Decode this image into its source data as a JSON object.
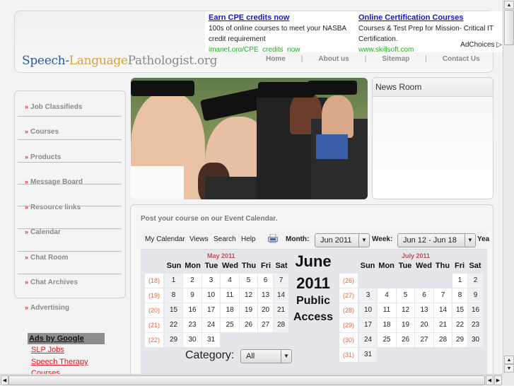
{
  "site": {
    "logo": {
      "part1": "Speech-",
      "part2": "Language",
      "part3": "Pathologist.org"
    }
  },
  "top_ads": [
    {
      "title": "Earn CPE credits now",
      "body": "100s of online courses to meet your NASBA credit requirement",
      "url": "imanet.org/CPE_credits_now"
    },
    {
      "title": "Online Certification Courses",
      "body": "Courses & Test Prep for Mission- Critical IT Certification.",
      "url": "www.skillsoft.com"
    }
  ],
  "adchoices": {
    "label": "AdChoices",
    "icon": "adchoices-triangle-icon"
  },
  "topnav": {
    "items": [
      "Home",
      "About us",
      "Sitemap",
      "Contact Us"
    ],
    "separator": "|"
  },
  "sidebar": {
    "bullet": "»",
    "items": [
      "Job Classifieds",
      "Courses",
      "Products",
      "Message Board",
      "Resource links",
      "Calendar",
      "Chat Room",
      "Chat Archives",
      "Advertising"
    ]
  },
  "sidebar_ads": {
    "header": "Ads by Google",
    "links": [
      "SLP Jobs",
      "Speech Therapy",
      "Courses"
    ]
  },
  "hero": {
    "alt": "Smiling graduates in caps and gowns"
  },
  "news_room": {
    "title": "News Room"
  },
  "calendar": {
    "note": "Post your course on our Event Calendar.",
    "toolbar": {
      "menu": [
        "My Calendar",
        "Views",
        "Search",
        "Help"
      ],
      "print_icon": "print-icon",
      "month_label": "Month:",
      "month_value": "Jun 2011",
      "week_label": "Week:",
      "week_value": "Jun 12 - Jun 18",
      "year_label": "Yea"
    },
    "center": {
      "month": "June",
      "year": "2011",
      "line3": "Public",
      "line4": "Access"
    },
    "days_of_week": [
      "Sun",
      "Mon",
      "Tue",
      "Wed",
      "Thu",
      "Fri",
      "Sat"
    ],
    "prev_month": {
      "label": "May 2011",
      "weeks": [
        {
          "week": "(18)",
          "days": [
            "1",
            "2",
            "3",
            "4",
            "5",
            "6",
            "7"
          ]
        },
        {
          "week": "(19)",
          "days": [
            "8",
            "9",
            "10",
            "11",
            "12",
            "13",
            "14"
          ]
        },
        {
          "week": "(20)",
          "days": [
            "15",
            "16",
            "17",
            "18",
            "19",
            "20",
            "21"
          ]
        },
        {
          "week": "(21)",
          "days": [
            "22",
            "23",
            "24",
            "25",
            "26",
            "27",
            "28"
          ]
        },
        {
          "week": "(22)",
          "days": [
            "29",
            "30",
            "31",
            "",
            "",
            "",
            ""
          ]
        }
      ]
    },
    "next_month": {
      "label": "July 2011",
      "weeks": [
        {
          "week": "(26)",
          "days": [
            "",
            "",
            "",
            "",
            "",
            "1",
            "2"
          ]
        },
        {
          "week": "(27)",
          "days": [
            "3",
            "4",
            "5",
            "6",
            "7",
            "8",
            "9"
          ]
        },
        {
          "week": "(28)",
          "days": [
            "10",
            "11",
            "12",
            "13",
            "14",
            "15",
            "16"
          ]
        },
        {
          "week": "(29)",
          "days": [
            "17",
            "18",
            "19",
            "20",
            "21",
            "22",
            "23"
          ]
        },
        {
          "week": "(30)",
          "days": [
            "24",
            "25",
            "26",
            "27",
            "28",
            "29",
            "30"
          ]
        },
        {
          "week": "(31)",
          "days": [
            "31",
            "",
            "",
            "",
            "",
            "",
            ""
          ]
        }
      ]
    },
    "category": {
      "label": "Category:",
      "value": "All"
    }
  },
  "colors": {
    "ad_title": "#1515c8",
    "ad_url": "#22aa22",
    "sidebar_bullet": "#c43a3a",
    "sidebar_ad_link": "#e01a1a",
    "month_label": "#c0504d",
    "week_number": "#e8643a"
  }
}
